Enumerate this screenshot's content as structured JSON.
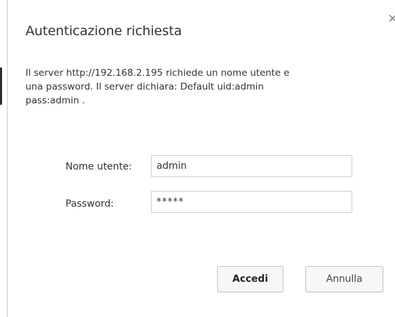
{
  "dialog": {
    "title": "Autenticazione richiesta",
    "close_label": "×",
    "message_line1": "Il server http://192.168.2.195 richiede un nome utente e",
    "message_line2": "una password. Il server dichiara: Default uid:admin",
    "message_line3": "pass:admin ."
  },
  "form": {
    "username_label": "Nome utente:",
    "username_value": "admin",
    "password_label": "Password:",
    "password_value": "*****"
  },
  "buttons": {
    "ok_label": "Accedi",
    "cancel_label": "Annulla"
  }
}
